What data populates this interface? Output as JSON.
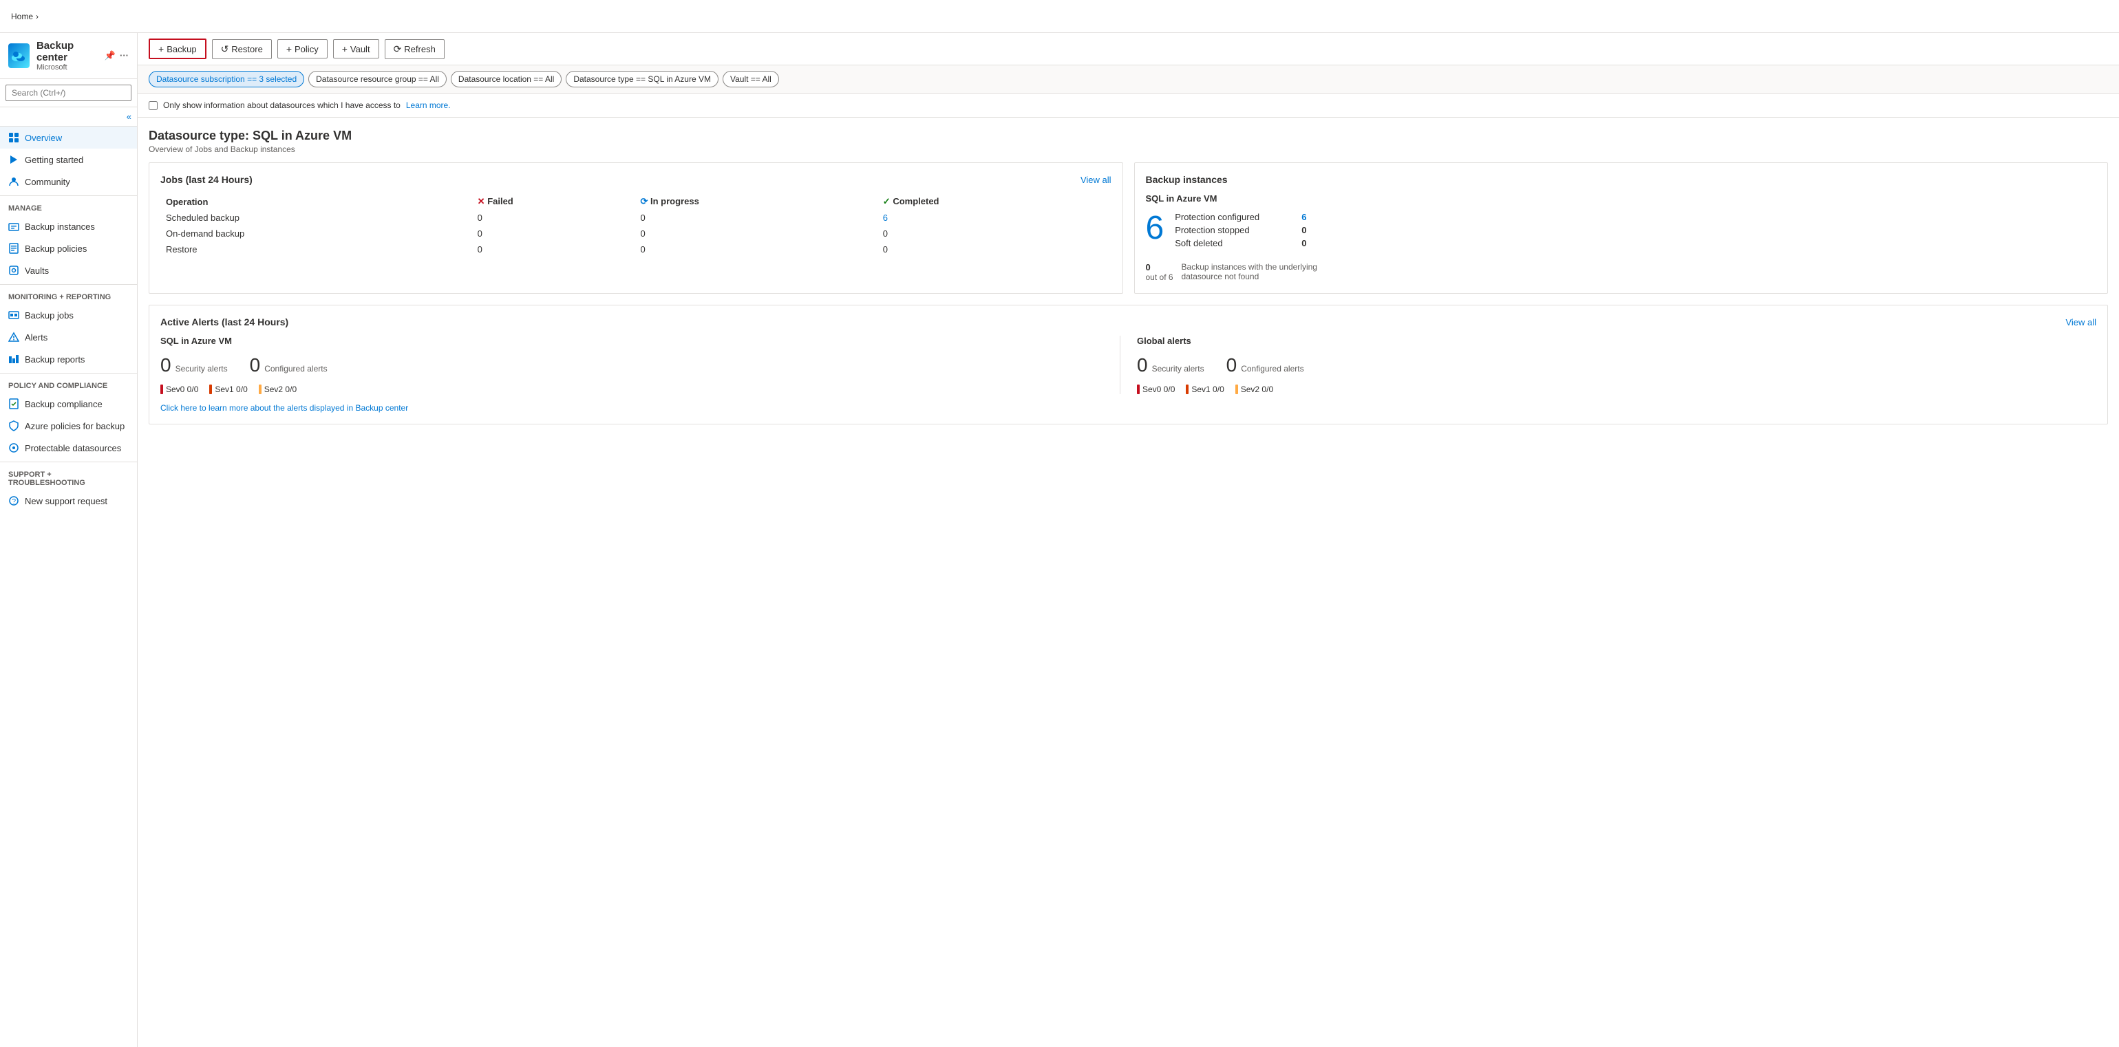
{
  "breadcrumb": {
    "home_label": "Home",
    "chevron": "›"
  },
  "app": {
    "title": "Backup center",
    "subtitle": "Microsoft",
    "pin_icon": "📌",
    "more_icon": "..."
  },
  "toolbar": {
    "backup_label": "Backup",
    "restore_label": "Restore",
    "policy_label": "Policy",
    "vault_label": "Vault",
    "refresh_label": "Refresh"
  },
  "filters": {
    "subscription_label": "Datasource subscription == 3 selected",
    "resource_group_label": "Datasource resource group == All",
    "location_label": "Datasource location == All",
    "datasource_type_label": "Datasource type == SQL in Azure VM",
    "vault_label": "Vault == All"
  },
  "checkbox": {
    "label": "Only show information about datasources which I have access to",
    "link_text": "Learn more."
  },
  "datasource": {
    "title": "Datasource type: SQL in Azure VM",
    "subtitle": "Overview of Jobs and Backup instances"
  },
  "jobs_card": {
    "title": "Jobs (last 24 Hours)",
    "view_all": "View all",
    "headers": {
      "operation": "Operation",
      "failed": "Failed",
      "in_progress": "In progress",
      "completed": "Completed"
    },
    "rows": [
      {
        "operation": "Scheduled backup",
        "failed": "0",
        "in_progress": "0",
        "completed": "6"
      },
      {
        "operation": "On-demand backup",
        "failed": "0",
        "in_progress": "0",
        "completed": "0"
      },
      {
        "operation": "Restore",
        "failed": "0",
        "in_progress": "0",
        "completed": "0"
      }
    ]
  },
  "backup_instances_card": {
    "title": "Backup instances",
    "section_title": "SQL in Azure VM",
    "main_number": "6",
    "protection_configured_label": "Protection configured",
    "protection_configured_value": "6",
    "protection_stopped_label": "Protection stopped",
    "protection_stopped_value": "0",
    "soft_deleted_label": "Soft deleted",
    "soft_deleted_value": "0",
    "footer_number": "0",
    "footer_sub": "out of 6",
    "footer_text": "Backup instances with the underlying datasource not found"
  },
  "alerts_card": {
    "title": "Active Alerts (last 24 Hours)",
    "view_all": "View all",
    "sql_section": {
      "title": "SQL in Azure VM",
      "security_alerts_count": "0",
      "security_alerts_label": "Security alerts",
      "configured_alerts_count": "0",
      "configured_alerts_label": "Configured alerts",
      "sev0": "Sev0  0/0",
      "sev1": "Sev1  0/0",
      "sev2": "Sev2  0/0"
    },
    "global_section": {
      "title": "Global alerts",
      "security_alerts_count": "0",
      "security_alerts_label": "Security alerts",
      "configured_alerts_count": "0",
      "configured_alerts_label": "Configured alerts",
      "sev0": "Sev0  0/0",
      "sev1": "Sev1  0/0",
      "sev2": "Sev2  0/0"
    },
    "learn_more_text": "Click here to learn more about the alerts displayed in Backup center"
  },
  "sidebar": {
    "search_placeholder": "Search (Ctrl+/)",
    "items": [
      {
        "label": "Overview",
        "section": "top",
        "active": true
      },
      {
        "label": "Getting started",
        "section": "top"
      },
      {
        "label": "Community",
        "section": "top"
      }
    ],
    "manage_label": "Manage",
    "manage_items": [
      {
        "label": "Backup instances"
      },
      {
        "label": "Backup policies"
      },
      {
        "label": "Vaults"
      }
    ],
    "monitoring_label": "Monitoring + reporting",
    "monitoring_items": [
      {
        "label": "Backup jobs"
      },
      {
        "label": "Alerts"
      },
      {
        "label": "Backup reports"
      }
    ],
    "policy_label": "Policy and compliance",
    "policy_items": [
      {
        "label": "Backup compliance"
      },
      {
        "label": "Azure policies for backup"
      },
      {
        "label": "Protectable datasources"
      }
    ],
    "support_label": "Support + troubleshooting",
    "support_items": [
      {
        "label": "New support request"
      }
    ]
  }
}
